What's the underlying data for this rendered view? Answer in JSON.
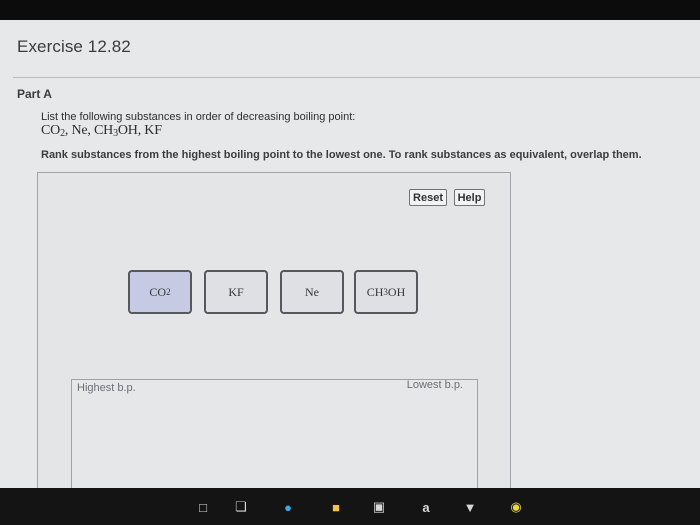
{
  "exercise": {
    "title": "Exercise 12.82"
  },
  "part": {
    "label": "Part A"
  },
  "prompt": {
    "instruction": "List the following substances in order of decreasing boiling point:",
    "substances_line": "CO2, Ne, CH3OH, KF",
    "rank_instruction": "Rank substances from the highest boiling point to the lowest one. To rank substances as equivalent, overlap them."
  },
  "toolbar": {
    "reset_label": "Reset",
    "help_label": "Help"
  },
  "tiles": [
    {
      "id": "co2",
      "label": "CO2",
      "selected": true
    },
    {
      "id": "kf",
      "label": "KF",
      "selected": false
    },
    {
      "id": "ne",
      "label": "Ne",
      "selected": false
    },
    {
      "id": "ch3oh",
      "label": "CH3OH",
      "selected": false
    }
  ],
  "ranking": {
    "highest_label": "Highest b.p.",
    "lowest_label": "Lowest b.p."
  },
  "taskbar": {
    "icons": [
      "window-icon",
      "tabs-icon",
      "browser-icon",
      "file-icon",
      "store-icon",
      "app-a-icon",
      "vpn-icon",
      "chrome-icon"
    ],
    "app_letter": "a"
  },
  "colors": {
    "selected_tile": "#c6cae3",
    "tile": "#dfe0e4",
    "panel": "#e7e8ea"
  }
}
